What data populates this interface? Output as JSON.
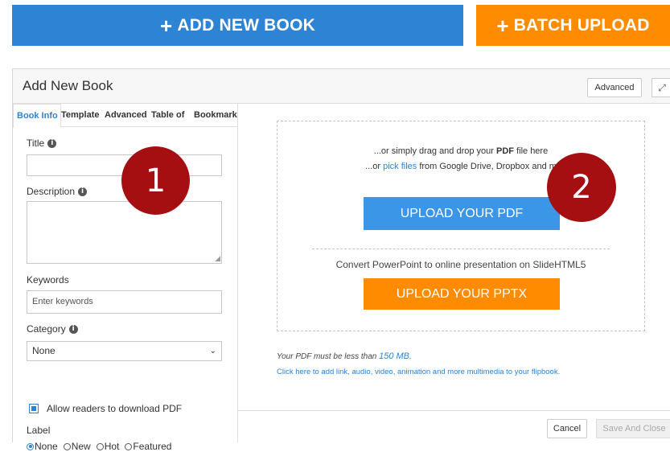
{
  "top_buttons": {
    "add_new_book": "ADD NEW BOOK",
    "batch_upload": "BATCH UPLOAD",
    "plus_icon": "+"
  },
  "panel": {
    "title": "Add New Book",
    "advanced_button": "Advanced",
    "expand_icon": "⤢"
  },
  "tabs": [
    {
      "label": "Book Info",
      "active": true
    },
    {
      "label": "Template",
      "active": false
    },
    {
      "label": "Advanced",
      "active": false
    },
    {
      "label": "Table of",
      "active": false
    },
    {
      "label": "Bookmark",
      "active": false
    }
  ],
  "form": {
    "title_label": "Title",
    "title_value": "",
    "description_label": "Description",
    "description_value": "",
    "keywords_label": "Keywords",
    "keywords_placeholder": "Enter keywords",
    "category_label": "Category",
    "category_selected": "None",
    "allow_download_label": "Allow readers to download PDF",
    "allow_download_checked": true,
    "label_label": "Label",
    "label_options": [
      {
        "label": "None",
        "selected": true
      },
      {
        "label": "New",
        "selected": false
      },
      {
        "label": "Hot",
        "selected": false
      },
      {
        "label": "Featured",
        "selected": false
      }
    ]
  },
  "upload": {
    "drag_line_prefix": "...or simply drag and drop your ",
    "drag_line_pdf": "PDF",
    "drag_line_suffix": " file here",
    "pick_line_prefix": "...or ",
    "pick_line_link": "pick files",
    "pick_line_suffix": " from Google Drive, Dropbox and m",
    "upload_pdf_button": "UPLOAD YOUR PDF",
    "convert_text": "Convert PowerPoint to online presentation on SlideHTML5",
    "upload_pptx_button": "UPLOAD YOUR PPTX",
    "size_note_prefix": "Your PDF must be less than ",
    "size_note_value": "150 MB.",
    "multimedia_link": "Click here to add link, audio, video, animation and more multimedia to your flipbook."
  },
  "footer": {
    "cancel": "Cancel",
    "save_and_close": "Save And Close"
  },
  "markers": [
    "1",
    "2"
  ],
  "colors": {
    "add_button": "#2d83d4",
    "batch_button": "#ff8c00",
    "upload_pdf": "#3b96e8",
    "upload_pptx": "#ff8c00",
    "marker": "#a50f12"
  }
}
